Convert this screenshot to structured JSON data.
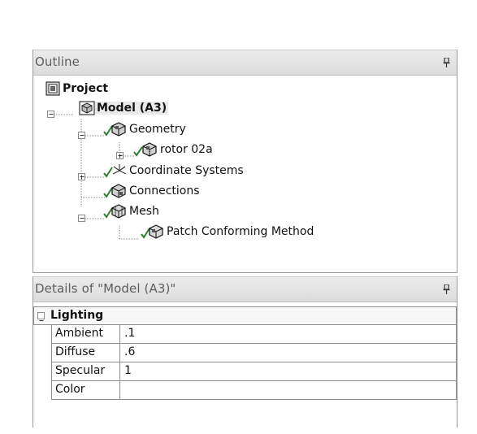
{
  "outline": {
    "title": "Outline",
    "tree": {
      "project": "Project",
      "model": "Model (A3)",
      "geometry": "Geometry",
      "rotor": "rotor 02a",
      "coordinate_systems": "Coordinate Systems",
      "connections": "Connections",
      "mesh": "Mesh",
      "patch_conforming": "Patch Conforming Method"
    }
  },
  "details": {
    "title": "Details of \"Model (A3)\"",
    "category": "Lighting",
    "rows": [
      {
        "name": "Ambient",
        "value": ".1"
      },
      {
        "name": "Diffuse",
        "value": ".6"
      },
      {
        "name": "Specular",
        "value": "1"
      },
      {
        "name": "Color",
        "value": ""
      }
    ]
  },
  "colors": {
    "header_bg": "#e0e0e0",
    "header_text": "#5e5e5e",
    "grid_border": "#8f8f8f",
    "check_green": "#2f7d2f"
  }
}
